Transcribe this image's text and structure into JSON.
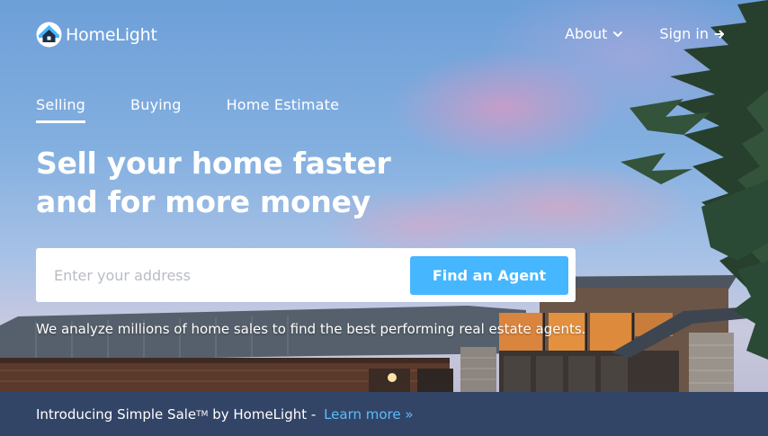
{
  "brand": {
    "name": "HomeLight"
  },
  "nav": {
    "about_label": "About",
    "signin_label": "Sign in"
  },
  "tabs": [
    {
      "label": "Selling",
      "active": true
    },
    {
      "label": "Buying",
      "active": false
    },
    {
      "label": "Home Estimate",
      "active": false
    }
  ],
  "hero": {
    "headline_line1": "Sell your home faster",
    "headline_line2": "and for more money",
    "subtext": "We analyze millions of home sales to find the best performing real estate agents."
  },
  "search": {
    "placeholder": "Enter your address",
    "value": "",
    "button_label": "Find an Agent"
  },
  "banner": {
    "text_prefix": "Introducing Simple Sale",
    "trademark": "TM",
    "text_suffix": " by HomeLight - ",
    "link_label": "Learn more »"
  },
  "icons": {
    "logo": "house-logo-icon",
    "about": "chevron-down-icon",
    "signin": "arrow-right-icon"
  },
  "colors": {
    "accent": "#46b6ff",
    "link": "#5bbcff",
    "banner_bg": "#203458",
    "logo_blue": "#46b6ff"
  }
}
